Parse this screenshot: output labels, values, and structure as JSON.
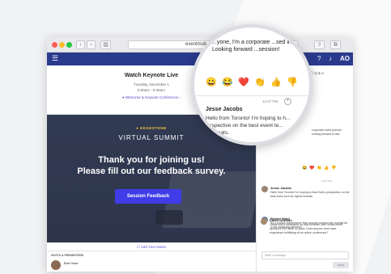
{
  "browser": {
    "url": "eventmob...",
    "nav_back": "‹",
    "nav_forward": "›",
    "sidebar_icon": "▥",
    "share_icon": "⇧",
    "tabs_icon": "⧉"
  },
  "appbar": {
    "menu_icon": "☰",
    "help_icon": "?",
    "bell_icon": "♪",
    "user_initials": "AO"
  },
  "header": {
    "title": "Watch Keynote Live",
    "date": "Tuesday, December 1",
    "time": "9:00am - 9:45am",
    "tag": "● Welcome & Keynote Conference ›"
  },
  "hero": {
    "brand": "● EDGESTONE",
    "event_name": "VIRTUAL SUMMIT",
    "thanks_line1": "Thank you for joining us!",
    "thanks_line2": "Please fill out our feedback survey.",
    "cta_label": "Session Feedback"
  },
  "notes": {
    "label": "☐ Add Your Notes"
  },
  "hosts": {
    "label": "HOSTS & PRESENTERS",
    "presenter_name": "Bob Hose"
  },
  "chat": {
    "qa_tab": "☐ Q & A",
    "preview_text": "corporate event planner coming forward to this",
    "timestamp": "12:07 PM",
    "messages": [
      {
        "name": "Jesse Jacobs",
        "text": "Hello from Toronto! I'm hoping to hear Bob's perspective on the best event tech for hybrid formats."
      },
      {
        "name": "Robert Ward",
        "text": "It's 3 o'clock somewhere! Has anyone cracked the cocktail kit in the swag bag delivery?"
      },
      {
        "name": "David Guzman",
        "text": "I think Bob's comments on how to better offer virtual event sponsors ROI were on point. Does anyone here have experience exhibiting at an online conference?"
      }
    ],
    "input_placeholder": "Write a message",
    "send_label": "Send",
    "mini_emojis": [
      "😂",
      "❤️",
      "👏",
      "👍",
      "👎"
    ]
  },
  "magnifier": {
    "text_top": "...yone, I'm a corporate ...sed in NYC. Looking forward ...session!",
    "emojis": [
      "😀",
      "😂",
      "❤️",
      "👏",
      "👍",
      "👎"
    ],
    "timestamp": "12:07 PM",
    "plus": "+",
    "name": "Jesse Jacobs",
    "text_bottom": "Hello from Toronto! I'm hoping to h... ...rspective on the best event te... ...formats."
  }
}
